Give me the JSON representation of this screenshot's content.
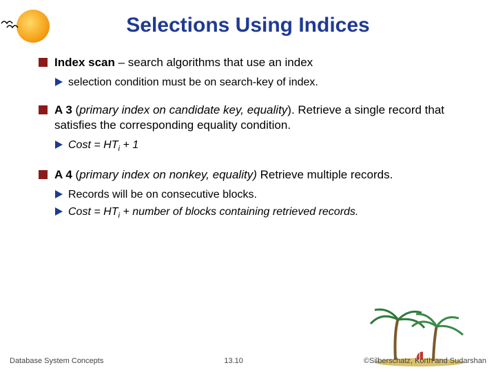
{
  "title": "Selections Using Indices",
  "items": [
    {
      "main_html": "<b>Index scan</b> – search algorithms that use an index",
      "subs": [
        {
          "html": "selection condition must be on search-key of index."
        }
      ]
    },
    {
      "main_html": "<b>A 3</b> (<i>primary index on candidate key, equality</i>).  Retrieve a single record that satisfies the corresponding equality condition.",
      "subs": [
        {
          "html": "<i>Cost = HT<span class=\"sub\">i</span> + 1</i>"
        }
      ]
    },
    {
      "main_html": "<b>A 4</b> (<i>primary index on nonkey, equality) </i>Retrieve multiple records.",
      "subs": [
        {
          "html": "Records will be on consecutive blocks."
        },
        {
          "html": "<i>Cost = HT<span class=\"sub\">i</span> + number of blocks containing retrieved records.</i>"
        }
      ]
    }
  ],
  "footer": {
    "left": "Database System Concepts",
    "center": "13.10",
    "right": "©Silberschatz, Korth and Sudarshan"
  }
}
